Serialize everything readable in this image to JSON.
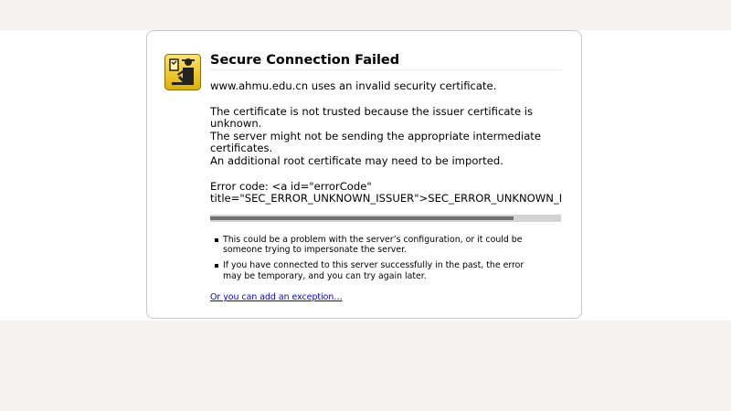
{
  "error": {
    "title": "Secure Connection Failed",
    "domain_message": "www.ahmu.edu.cn uses an invalid security certificate.",
    "details": [
      "The certificate is not trusted because the issuer certificate is unknown.",
      "The server might not be sending the appropriate intermediate certificates.",
      "An additional root certificate may need to be imported."
    ],
    "error_code_text": "Error code: <a id=\"errorCode\" title=\"SEC_ERROR_UNKNOWN_ISSUER\">SEC_ERROR_UNKNOWN_ISSU",
    "technical_bar_fill": 0.865
  },
  "reasons": [
    "This could be a problem with the server’s configuration, or it could be someone trying to impersonate the server.",
    "If you have connected to this server successfully in the past, the error may be temporary, and you can try again later."
  ],
  "exception_link": "Or you can add an exception…",
  "icon": {
    "name": "security-officer-icon",
    "color": "#f0c419"
  }
}
